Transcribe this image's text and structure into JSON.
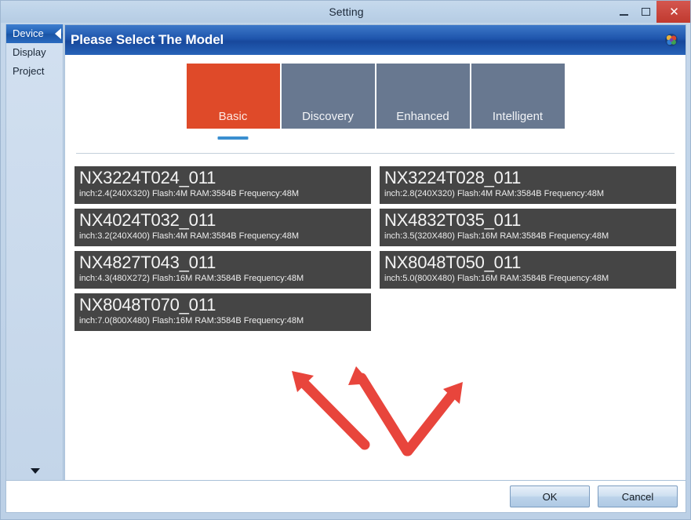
{
  "window": {
    "title": "Setting",
    "controls": {
      "minimize": "minimize-icon",
      "maximize": "maximize-icon",
      "close": "✕"
    }
  },
  "sidebar": {
    "items": [
      {
        "label": "Device",
        "selected": true
      },
      {
        "label": "Display",
        "selected": false
      },
      {
        "label": "Project",
        "selected": false
      }
    ],
    "scroll_down_icon": "triangle-down-icon"
  },
  "panel": {
    "title": "Please Select The Model",
    "logo_icon": "app-logo-icon"
  },
  "tabs": [
    {
      "label": "Basic",
      "active": true
    },
    {
      "label": "Discovery",
      "active": false
    },
    {
      "label": "Enhanced",
      "active": false
    },
    {
      "label": "Intelligent",
      "active": false
    }
  ],
  "models": [
    {
      "name": "NX3224T024_011",
      "spec": "inch:2.4(240X320) Flash:4M RAM:3584B Frequency:48M"
    },
    {
      "name": "NX3224T028_011",
      "spec": "inch:2.8(240X320) Flash:4M RAM:3584B Frequency:48M"
    },
    {
      "name": "NX4024T032_011",
      "spec": "inch:3.2(240X400) Flash:4M RAM:3584B Frequency:48M"
    },
    {
      "name": "NX4832T035_011",
      "spec": "inch:3.5(320X480) Flash:16M RAM:3584B Frequency:48M"
    },
    {
      "name": "NX4827T043_011",
      "spec": "inch:4.3(480X272) Flash:16M RAM:3584B Frequency:48M"
    },
    {
      "name": "NX8048T050_011",
      "spec": "inch:5.0(800X480) Flash:16M RAM:3584B Frequency:48M"
    },
    {
      "name": "NX8048T070_011",
      "spec": "inch:7.0(800X480) Flash:16M RAM:3584B Frequency:48M"
    }
  ],
  "footer": {
    "ok_label": "OK",
    "cancel_label": "Cancel"
  },
  "annotations": {
    "arrow_color": "#e8453c",
    "arrows": [
      {
        "name": "arrow-up-left"
      },
      {
        "name": "arrow-up"
      },
      {
        "name": "arrow-up-right"
      }
    ]
  },
  "colors": {
    "accent_orange": "#df4a29",
    "tab_gray": "#687890",
    "header_blue": "#1f56ad",
    "underline_blue": "#3a8fd0",
    "card_dark": "#454545"
  }
}
